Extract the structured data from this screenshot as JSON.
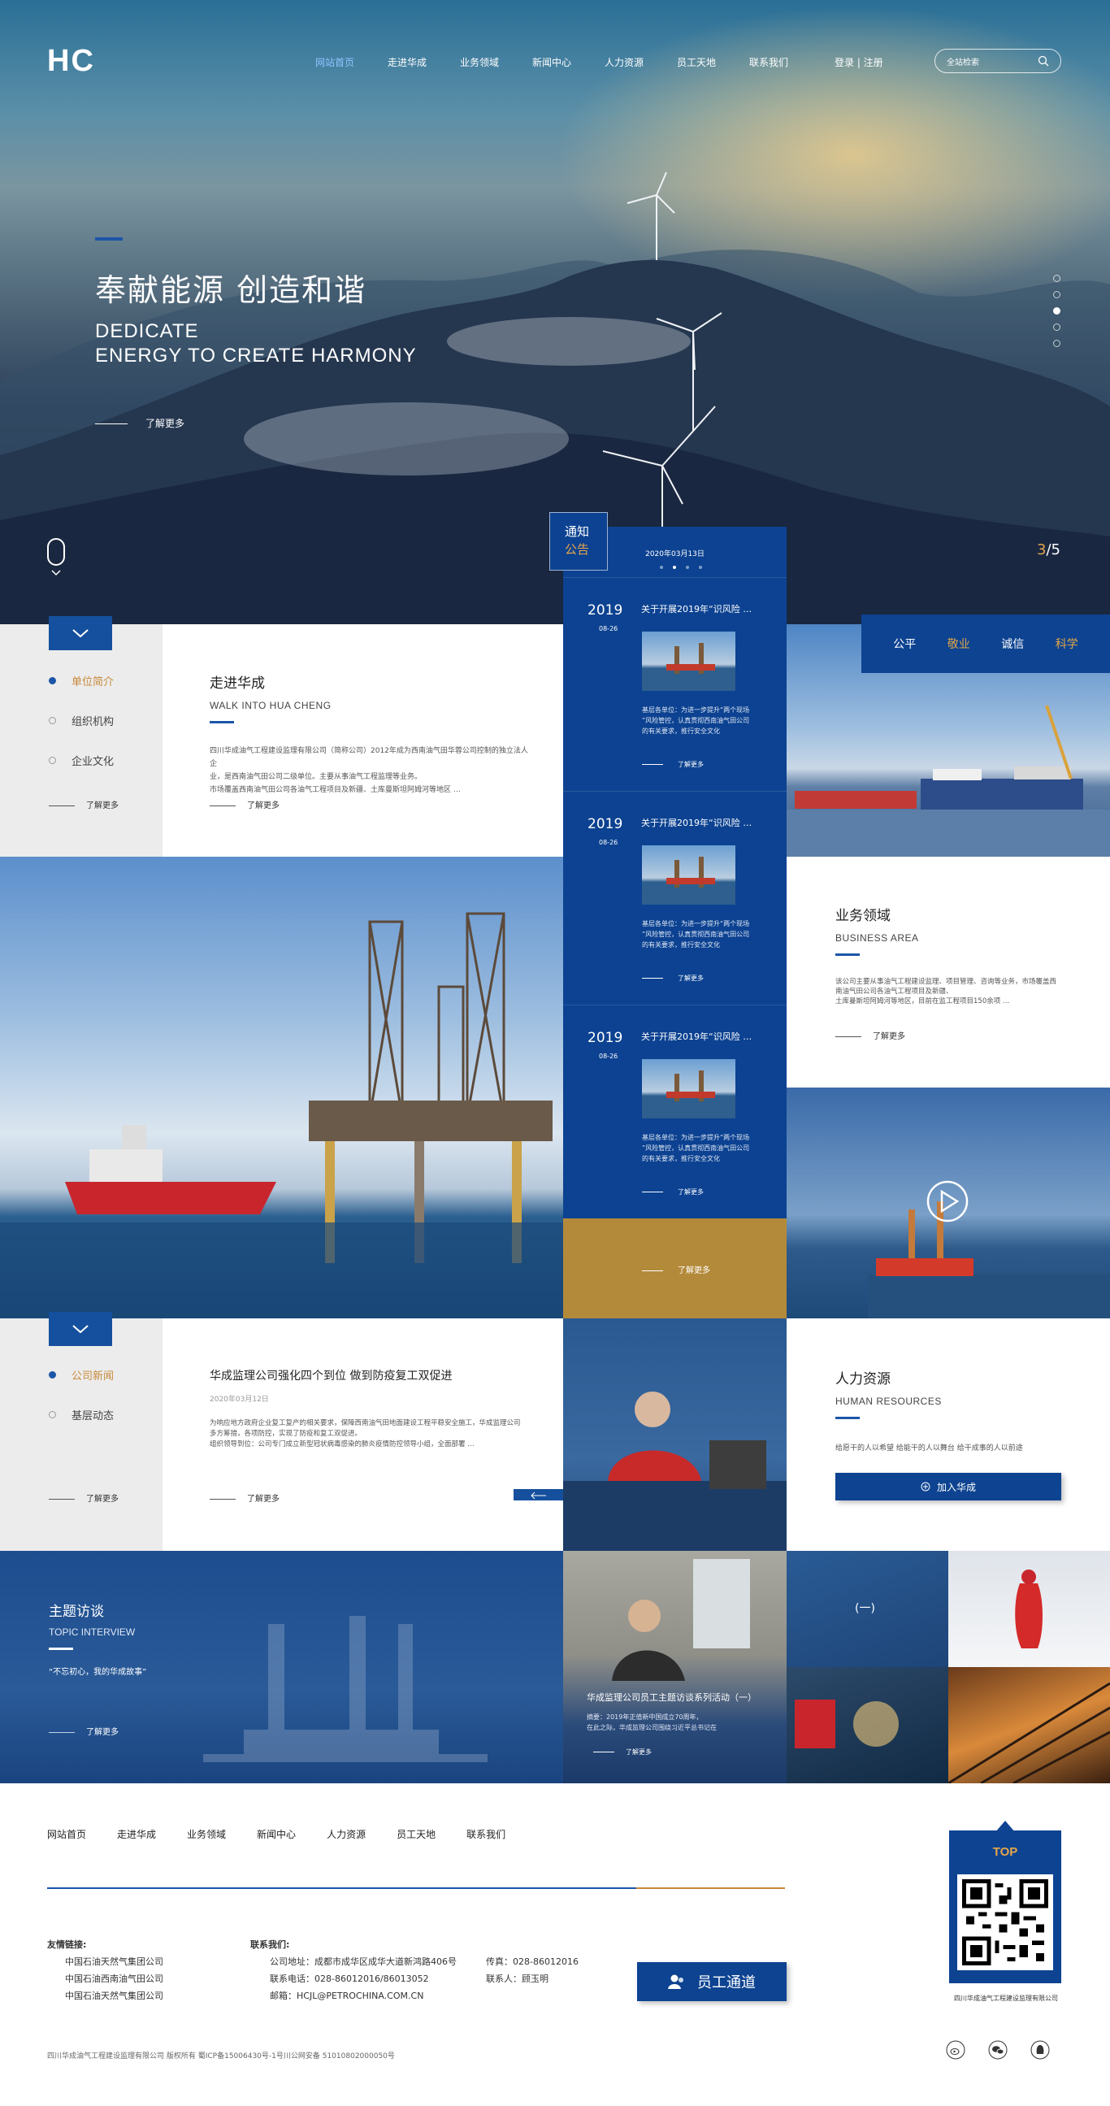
{
  "header": {
    "logo": "HC",
    "nav": [
      "网站首页",
      "走进华成",
      "业务领域",
      "新闻中心",
      "人力资源",
      "员工天地",
      "联系我们"
    ],
    "login": "登录 | 注册",
    "search_placeholder": "全站检索"
  },
  "hero": {
    "title_cn": "奉献能源 创造和谐",
    "title_en_1": "DEDICATE",
    "title_en_2": "ENERGY TO CREATE HARMONY",
    "more": "了解更多",
    "slide_current": "3",
    "slide_total": "5"
  },
  "about": {
    "side_items": [
      "单位简介",
      "组织机构",
      "企业文化"
    ],
    "side_more": "了解更多",
    "title": "走进华成",
    "subtitle": "WALK INTO HUA CHENG",
    "desc_1": "四川华成油气工程建设监理有限公司（简称公司）2012年成为西南油气田华蓉公司控制的独立法人企",
    "desc_2": "业，是西南油气田公司二级单位。主要从事油气工程监理等业务。",
    "desc_3": "市场覆盖西南油气田公司各油气工程项目及新疆、土库曼斯坦阿姆河等地区 …",
    "more": "了解更多"
  },
  "notice": {
    "tag_1": "通知",
    "tag_2": "公告",
    "date": "2020年03月13日",
    "items": [
      {
        "year": "2019",
        "date": "08-26",
        "title": "关于开展2019年“识风险 …",
        "desc_1": "基层各单位：为进一步提升“两个现场",
        "desc_2": "”风险管控，认真贯彻西南油气田公司",
        "desc_3": "的有关要求，推行安全文化",
        "more": "了解更多"
      },
      {
        "year": "2019",
        "date": "08-26",
        "title": "关于开展2019年“识风险 …",
        "desc_1": "基层各单位：为进一步提升“两个现场",
        "desc_2": "”风险管控，认真贯彻西南油气田公司",
        "desc_3": "的有关要求，推行安全文化",
        "more": "了解更多"
      },
      {
        "year": "2019",
        "date": "08-26",
        "title": "关于开展2019年“识风险 …",
        "desc_1": "基层各单位：为进一步提升“两个现场",
        "desc_2": "”风险管控，认真贯彻西南油气田公司",
        "desc_3": "的有关要求，推行安全文化",
        "more": "了解更多"
      }
    ],
    "gold_more": "了解更多"
  },
  "values": [
    "公平",
    "敬业",
    "诚信",
    "科学"
  ],
  "business": {
    "title": "业务领域",
    "subtitle": "BUSINESS AREA",
    "desc_1": "该公司主要从事油气工程建设监理、项目管理、咨询等业务，市场覆盖西",
    "desc_2": "南油气田公司各油气工程项目及新疆、",
    "desc_3": "土库曼斯坦阿姆河等地区，目前在监工程项目150余项 …",
    "more": "了解更多"
  },
  "news": {
    "side_items": [
      "公司新闻",
      "基层动态"
    ],
    "side_more": "了解更多",
    "title": "华成监理公司强化四个到位 做到防疫复工双促进",
    "date": "2020年03月12日",
    "desc_1": "为响应地方政府企业复工复产的相关要求，保障西南油气田地面建设工程平稳安全施工，华成监理公司",
    "desc_2": "多方筹措，各项防控，实现了防疫和复工双促进。",
    "desc_3": "组织领导到位：公司专门成立新型冠状病毒感染的肺炎疫情防控领导小组，全面部署 …",
    "more": "了解更多"
  },
  "hr": {
    "title": "人力资源",
    "subtitle": "HUMAN RESOURCES",
    "slogan": "给愿干的人以希望  给能干的人以舞台  给干成事的人以前途",
    "button": "加入华成"
  },
  "interview": {
    "title": "主题访谈",
    "subtitle": "TOPIC INTERVIEW",
    "quote": "“不忘初心，我的华成故事”",
    "more": "了解更多",
    "card_title": "华成监理公司员工主题访谈系列活动（一）",
    "card_desc_1": "摘要：2019年正值新中国成立70周年，",
    "card_desc_2": "在此之际，华成监理公司围绕习近平总书记在",
    "card_more": "了解更多",
    "gallery_label": "(一)"
  },
  "footer": {
    "nav": [
      "网站首页",
      "走进华成",
      "业务领域",
      "新闻中心",
      "人力资源",
      "员工天地",
      "联系我们"
    ],
    "links_title": "友情链接:",
    "links": [
      "中国石油天然气集团公司",
      "中国石油西南油气田公司",
      "中国石油天然气集团公司"
    ],
    "contact_title": "联系我们:",
    "address": "公司地址：成都市成华区成华大道新鸿路406号",
    "phone": "联系电话：028-86012016/86013052",
    "email": "邮箱：HCJL@PETROCHINA.COM.CN",
    "fax": "传真：028-86012016",
    "contact_person": "联系人：顾玉明",
    "staff_button": "员工通道",
    "top": "TOP",
    "qr_caption": "四川华成油气工程建设监理有限公司",
    "copyright": "四川华成油气工程建设监理有限公司 版权所有 蜀ICP备15006430号-1号川公网安备 51010802000050号"
  },
  "colors": {
    "brand_blue": "#0d4391",
    "accent_gold": "#c8893a",
    "nav_active": "#8fc3ff"
  }
}
